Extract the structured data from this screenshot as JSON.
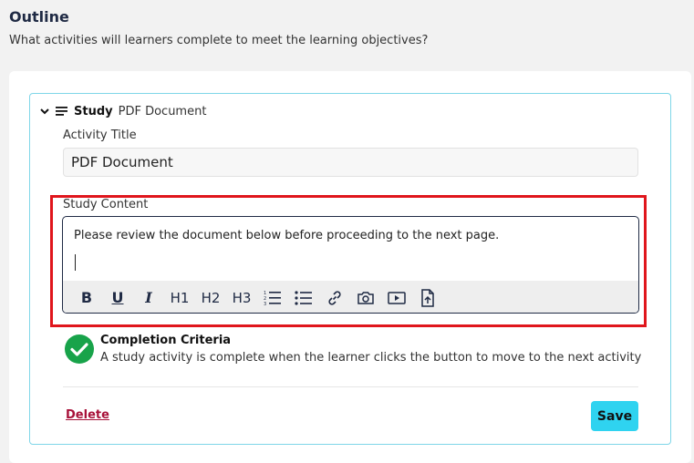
{
  "outline": {
    "title": "Outline",
    "subtitle": "What activities will learners complete to meet the learning objectives?"
  },
  "activity": {
    "type": "Study",
    "name": "PDF Document",
    "title_label": "Activity Title",
    "title_value": "PDF Document",
    "content_label": "Study Content",
    "content_text": "Please review the document below before proceeding to the next page.",
    "toolbar": {
      "bold": "B",
      "underline": "U",
      "italic": "I",
      "h1": "H1",
      "h2": "H2",
      "h3": "H3"
    },
    "completion": {
      "title": "Completion Criteria",
      "description": "A study activity is complete when the learner clicks the button to move to the next activity"
    },
    "delete_label": "Delete",
    "save_label": "Save"
  },
  "colors": {
    "accent": "#2fd3f0",
    "card_border": "#7fd6e8",
    "highlight": "#e0161c",
    "success": "#18a34a",
    "danger_link": "#a8123a"
  }
}
